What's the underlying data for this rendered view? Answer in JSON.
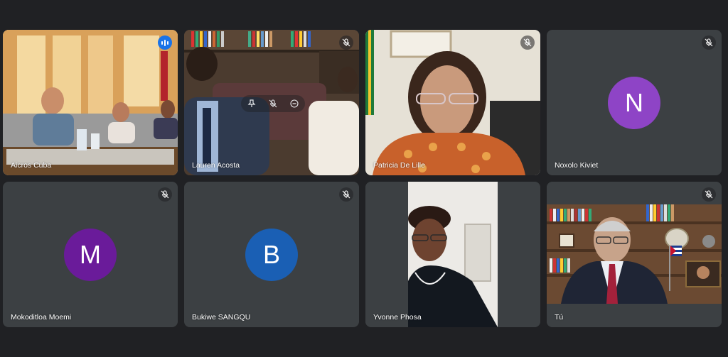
{
  "participants": [
    {
      "name": "Aicros Cuba",
      "status": "speaking"
    },
    {
      "name": "Lauren Acosta",
      "status": "muted"
    },
    {
      "name": "Patricia De Lille",
      "status": "muted"
    },
    {
      "name": "Noxolo Kiviet",
      "status": "muted",
      "initial": "N",
      "avatar_color": "#8e44c6"
    },
    {
      "name": "Mokoditloa Moemi",
      "status": "muted",
      "initial": "M",
      "avatar_color": "#6a1b9a"
    },
    {
      "name": "Bukiwe SANGQU",
      "status": "muted",
      "initial": "B",
      "avatar_color": "#1a5fb4"
    },
    {
      "name": "Yvonne Phosa",
      "status": "muted"
    },
    {
      "name": "Tú",
      "status": "muted"
    }
  ],
  "icons": {
    "mute": "mic-off-icon",
    "speaking": "audio-level-icon",
    "pin": "pin-icon",
    "remove": "remove-icon"
  },
  "colors": {
    "background": "#202124",
    "tile": "#3c4043",
    "active_border": "#8ab4f8",
    "speaking": "#1a73e8"
  }
}
